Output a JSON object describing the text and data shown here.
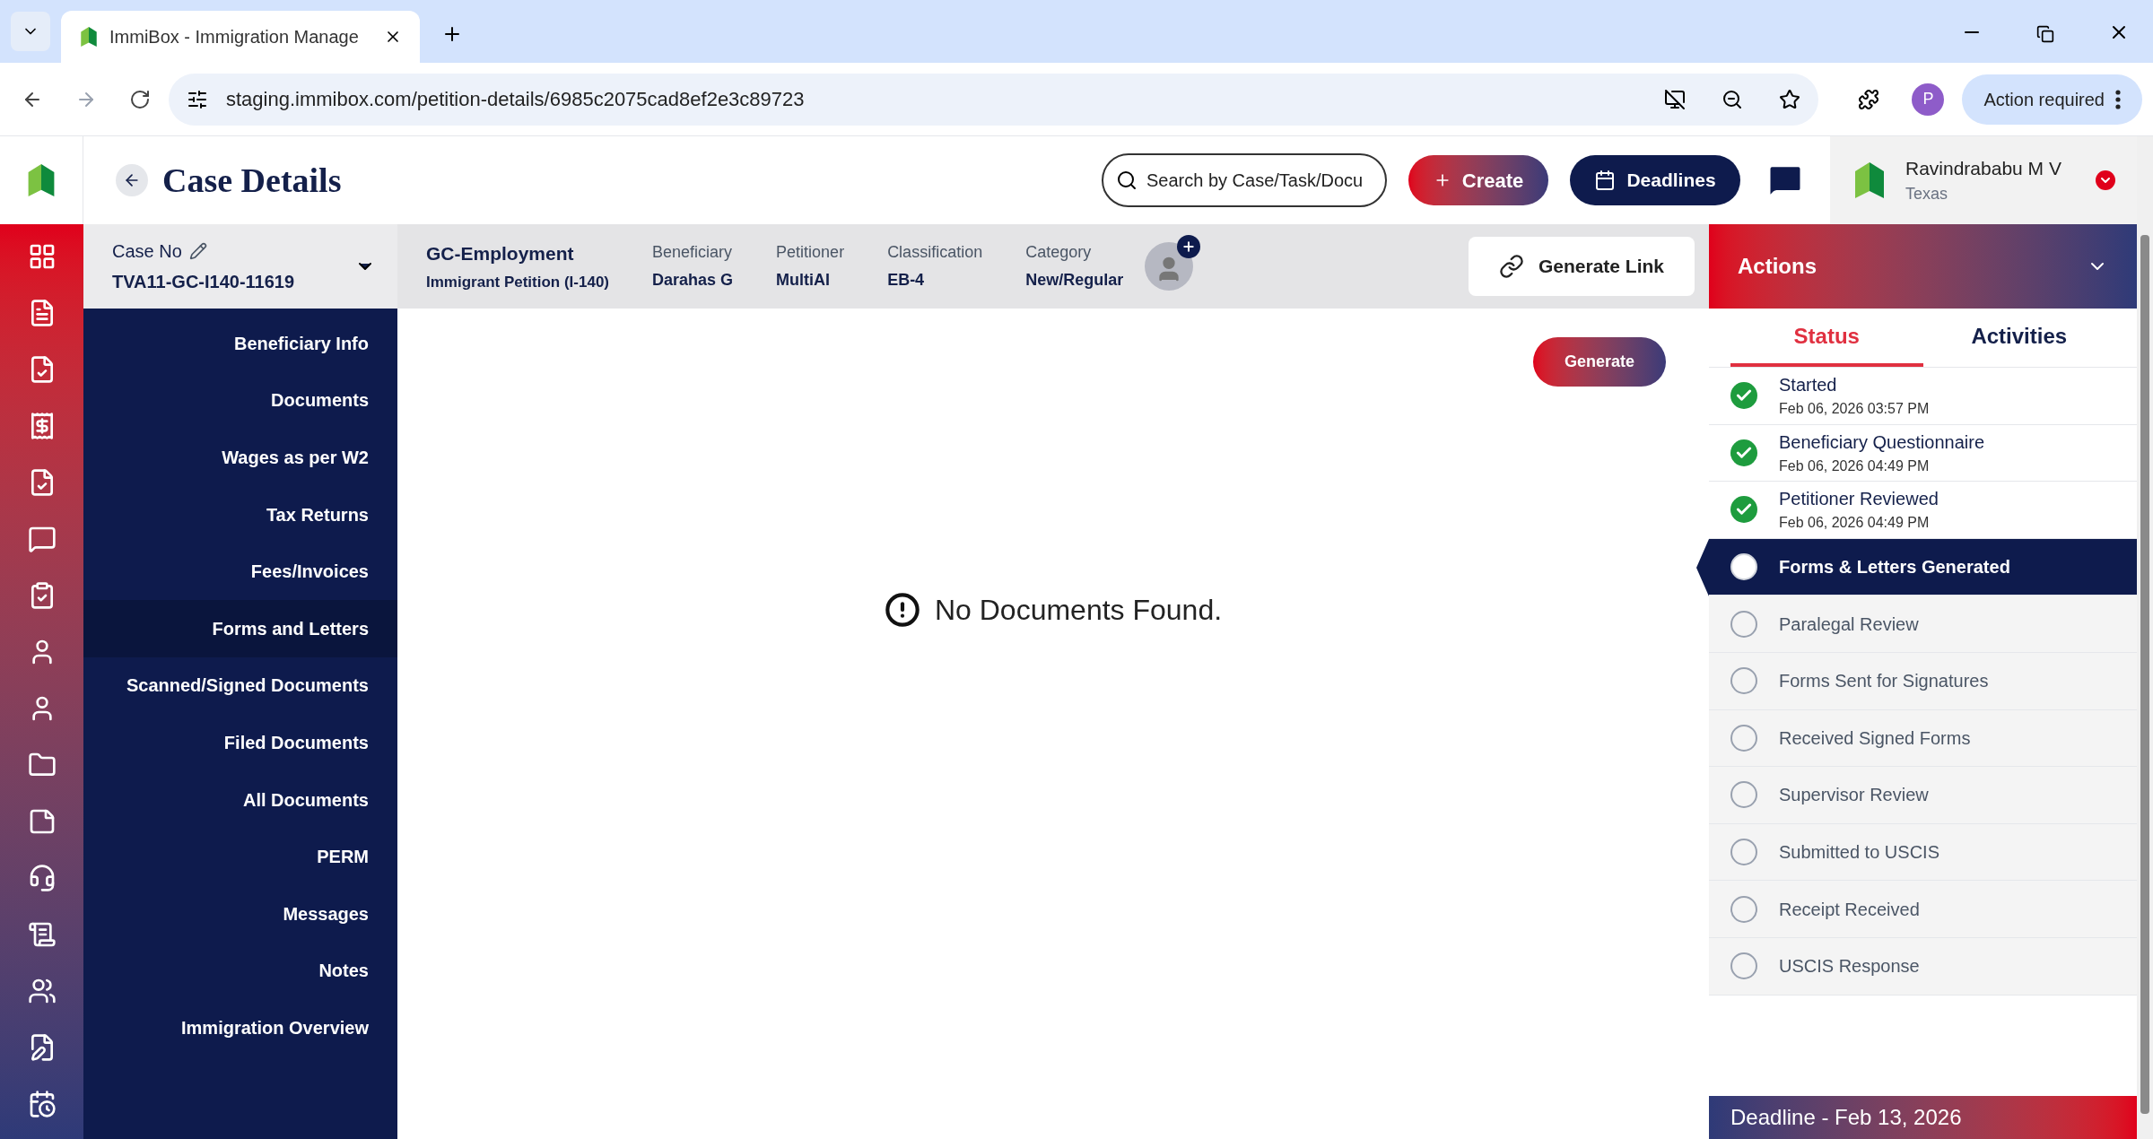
{
  "browser": {
    "tab_title": "ImmiBox - Immigration Manage",
    "url": "staging.immibox.com/petition-details/6985c2075cad8ef2e3c89723",
    "profile_initial": "P",
    "action_label": "Action required"
  },
  "header": {
    "title": "Case Details",
    "search_placeholder": "Search by Case/Task/Docu",
    "create_label": "Create",
    "deadlines_label": "Deadlines",
    "user_name": "Ravindrababu M V",
    "user_location": "Texas"
  },
  "case_bar": {
    "case_no_label": "Case No",
    "case_no": "TVA11-GC-I140-11619",
    "case_type": "GC-Employment",
    "petition": "Immigrant Petition (I-140)",
    "fields": [
      {
        "label": "Beneficiary",
        "value": "Darahas G"
      },
      {
        "label": "Petitioner",
        "value": "MultiAI"
      },
      {
        "label": "Classification",
        "value": "EB-4"
      },
      {
        "label": "Category",
        "value": "New/Regular"
      }
    ],
    "generate_link_label": "Generate Link"
  },
  "nav": [
    {
      "label": "Beneficiary Info",
      "selected": false
    },
    {
      "label": "Documents",
      "selected": false
    },
    {
      "label": "Wages as per W2",
      "selected": false
    },
    {
      "label": "Tax Returns",
      "selected": false
    },
    {
      "label": "Fees/Invoices",
      "selected": false
    },
    {
      "label": "Forms and Letters",
      "selected": true
    },
    {
      "label": "Scanned/Signed Documents",
      "selected": false
    },
    {
      "label": "Filed Documents",
      "selected": false
    },
    {
      "label": "All Documents",
      "selected": false
    },
    {
      "label": "PERM",
      "selected": false
    },
    {
      "label": "Messages",
      "selected": false
    },
    {
      "label": "Notes",
      "selected": false
    },
    {
      "label": "Immigration Overview",
      "selected": false
    }
  ],
  "main": {
    "generate_label": "Generate",
    "empty_message": "No Documents Found."
  },
  "actions": {
    "title": "Actions",
    "tabs": [
      {
        "label": "Status",
        "selected": true
      },
      {
        "label": "Activities",
        "selected": false
      }
    ],
    "steps": [
      {
        "label": "Started",
        "date": "Feb 06, 2026 03:57 PM",
        "kind": "done"
      },
      {
        "label": "Beneficiary Questionnaire",
        "date": "Feb 06, 2026 04:49 PM",
        "kind": "done"
      },
      {
        "label": "Petitioner Reviewed",
        "date": "Feb 06, 2026 04:49 PM",
        "kind": "done"
      },
      {
        "label": "Forms & Letters Generated",
        "kind": "current"
      },
      {
        "label": "Paralegal Review",
        "kind": "pending"
      },
      {
        "label": "Forms Sent for Signatures",
        "kind": "pending"
      },
      {
        "label": "Received Signed Forms",
        "kind": "pending"
      },
      {
        "label": "Supervisor Review",
        "kind": "pending"
      },
      {
        "label": "Submitted to USCIS",
        "kind": "pending"
      },
      {
        "label": "Receipt Received",
        "kind": "pending"
      },
      {
        "label": "USCIS Response",
        "kind": "pending"
      }
    ],
    "deadline": "Deadline - Feb 13, 2026"
  }
}
